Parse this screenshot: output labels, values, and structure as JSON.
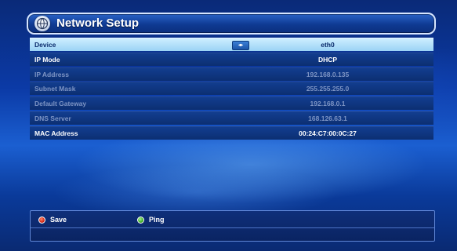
{
  "header": {
    "title": "Network Setup",
    "icon": "network-globe-icon"
  },
  "rows": [
    {
      "label": "Device",
      "value": "eth0",
      "state": "selected",
      "has_arrows": true,
      "arrows_glyph": "◂▸"
    },
    {
      "label": "IP Mode",
      "value": "DHCP",
      "state": "enabled"
    },
    {
      "label": "IP Address",
      "value": "192.168.0.135",
      "state": "disabled"
    },
    {
      "label": "Subnet Mask",
      "value": "255.255.255.0",
      "state": "disabled"
    },
    {
      "label": "Default Gateway",
      "value": "192.168.0.1",
      "state": "disabled"
    },
    {
      "label": "DNS Server",
      "value": "168.126.63.1",
      "state": "disabled"
    },
    {
      "label": "MAC Address",
      "value": "00:24:C7:00:0C:27",
      "state": "enabled"
    }
  ],
  "footer": {
    "save_label": "Save",
    "ping_label": "Ping",
    "save_color": "#d2291a",
    "ping_color": "#3fae2a"
  }
}
